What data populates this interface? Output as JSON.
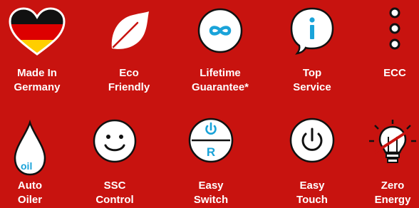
{
  "background_color": "#c8130f",
  "features": [
    {
      "icon": "germany-heart-icon",
      "line1": "Made In",
      "line2": "Germany"
    },
    {
      "icon": "leaf-icon",
      "line1": "Eco",
      "line2": "Friendly"
    },
    {
      "icon": "infinity-icon",
      "line1": "Lifetime",
      "line2": "Guarantee*"
    },
    {
      "icon": "info-speech-bubble-icon",
      "line1": "Top",
      "line2": "Service"
    },
    {
      "icon": "ecc-dots-icon",
      "line1": "ECC",
      "line2": ""
    },
    {
      "icon": "oil-drop-icon",
      "line1": "Auto",
      "line2": "Oiler",
      "icon_text": "oil"
    },
    {
      "icon": "smiley-icon",
      "line1": "SSC",
      "line2": "Control"
    },
    {
      "icon": "switch-dial-icon",
      "line1": "Easy",
      "line2": "Switch",
      "icon_text": "R"
    },
    {
      "icon": "power-touch-icon",
      "line1": "Easy",
      "line2": "Touch"
    },
    {
      "icon": "zero-energy-bulb-icon",
      "line1": "Zero",
      "line2": "Energy"
    }
  ]
}
